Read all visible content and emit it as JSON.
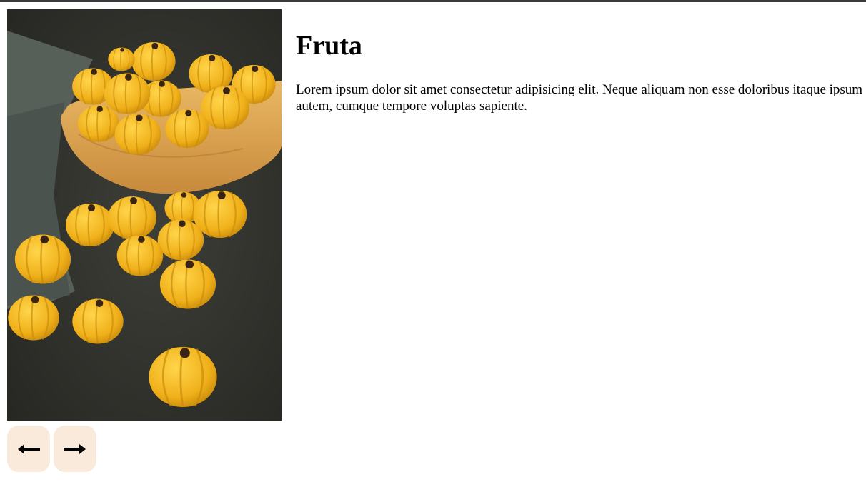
{
  "article": {
    "title": "Fruta",
    "body": "Lorem ipsum dolor sit amet consectetur adipisicing elit. Neque aliquam non esse doloribus itaque ipsum quibusdam autem, cumque tempore voluptas sapiente."
  },
  "image": {
    "subject": "pumpkin-shaped cookies in a wooden bowl",
    "colors": {
      "background": "#2f302c",
      "pumpkin": "#f2b81e",
      "bowl": "#d9a24e",
      "cloth": "#5d6660"
    }
  },
  "carousel": {
    "prev_icon": "arrow-left-icon",
    "next_icon": "arrow-right-icon",
    "button_color": "#faeadb"
  }
}
